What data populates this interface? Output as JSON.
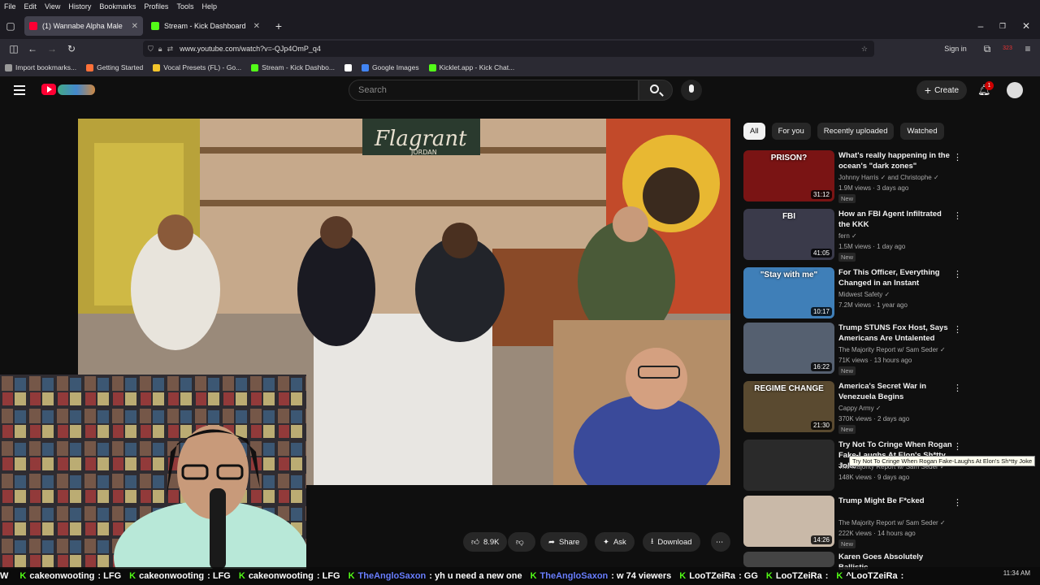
{
  "menubar": [
    "File",
    "Edit",
    "View",
    "History",
    "Bookmarks",
    "Profiles",
    "Tools",
    "Help"
  ],
  "tabs": [
    {
      "label": "(1) Wannabe Alpha Male Ex",
      "color": "#ff0033"
    },
    {
      "label": "Stream - Kick Dashboard",
      "color": "#53fc18"
    }
  ],
  "url": "www.youtube.com/watch?v=-QJp4OmP_q4",
  "nav_right": {
    "signin": "Sign in",
    "badge": "323"
  },
  "bookmarks": [
    {
      "label": "Import bookmarks...",
      "color": "#999999"
    },
    {
      "label": "Getting Started",
      "color": "#ff7139"
    },
    {
      "label": "Vocal Presets (FL) - Go...",
      "color": "#f3c52b"
    },
    {
      "label": "Stream - Kick Dashbo...",
      "color": "#53fc18"
    },
    {
      "label": "",
      "color": "#ffffff"
    },
    {
      "label": "Google Images",
      "color": "#4285f4"
    },
    {
      "label": "Kicklet.app - Kick Chat...",
      "color": "#53fc18"
    }
  ],
  "youtube": {
    "search_placeholder": "Search",
    "create": "Create",
    "notif_count": "1"
  },
  "chips": [
    "All",
    "For you",
    "Recently uploaded",
    "Watched"
  ],
  "recommendations": [
    {
      "title": "What's really happening in the ocean's \"dark zones\"",
      "channel": "Johnny Harris ✓ and Christophe ✓",
      "meta": "1.9M views · 3 days ago",
      "badge": "New",
      "duration": "31:12",
      "thumb_text": "PRISON?",
      "thumb_color": "#7a1414"
    },
    {
      "title": "How an FBI Agent Infiltrated the KKK",
      "channel": "fern ✓",
      "meta": "1.5M views · 1 day ago",
      "badge": "New",
      "duration": "41:05",
      "thumb_text": "FBI",
      "thumb_color": "#3a3a4a"
    },
    {
      "title": "For This Officer, Everything Changed in an Instant",
      "channel": "Midwest Safety ✓",
      "meta": "7.2M views · 1 year ago",
      "badge": "",
      "duration": "10:17",
      "thumb_text": "\"Stay with me\"",
      "thumb_color": "#3f7fb8"
    },
    {
      "title": "Trump STUNS Fox Host, Says Americans Are Untalented",
      "channel": "The Majority Report w/ Sam Seder ✓",
      "meta": "71K views · 13 hours ago",
      "badge": "New",
      "duration": "16:22",
      "thumb_text": "",
      "thumb_color": "#556070"
    },
    {
      "title": "America's Secret War in Venezuela Begins",
      "channel": "Cappy Army ✓",
      "meta": "370K views · 2 days ago",
      "badge": "New",
      "duration": "21:30",
      "thumb_text": "REGIME CHANGE",
      "thumb_color": "#5a4a30"
    },
    {
      "title": "Try Not To Cringe When Rogan Fake-Laughs At Elon's Sh*tty Joke",
      "channel": "The Majority Report w/ Sam Seder ✓",
      "meta": "148K views · 9 days ago",
      "badge": "",
      "duration": "",
      "thumb_text": "",
      "thumb_color": "#2a2a2a"
    },
    {
      "title": "Trump Might Be F*cked",
      "channel": "The Majority Report w/ Sam Seder ✓",
      "meta": "222K views · 14 hours ago",
      "badge": "New",
      "duration": "14:26",
      "thumb_text": "",
      "thumb_color": "#c9b9a8"
    },
    {
      "title": "Karen Goes Absolutely Ballistic",
      "channel": "",
      "meta": "",
      "badge": "",
      "duration": "",
      "thumb_text": "",
      "thumb_color": "#444444"
    }
  ],
  "tooltip": "Try Not To Cringe When Rogan Fake-Laughs At Elon's Sh*tty Joke",
  "actions": {
    "likes": "8.9K",
    "share": "Share",
    "ask": "Ask",
    "download": "Download"
  },
  "video": {
    "sign_text": "Flagrant",
    "sign_sub": "JORDAN"
  },
  "ticker": [
    {
      "user": "W",
      "msg": ""
    },
    {
      "user": "cakeonwooting",
      "msg": ": LFG"
    },
    {
      "user": "cakeonwooting",
      "msg": ": LFG"
    },
    {
      "user": "cakeonwooting",
      "msg": ": LFG"
    },
    {
      "user": "TheAngloSaxon",
      "msg": ": yh u need a new one",
      "blue": true
    },
    {
      "user": "TheAngloSaxon",
      "msg": ": w 74 viewers",
      "blue": true
    },
    {
      "user": "LooTZeiRa",
      "msg": ": GG"
    },
    {
      "user": "LooTZeiRa",
      "msg": ":"
    },
    {
      "user": "^LooTZeiRa",
      "msg": ":"
    }
  ],
  "clock": {
    "time": "11:34 AM"
  }
}
